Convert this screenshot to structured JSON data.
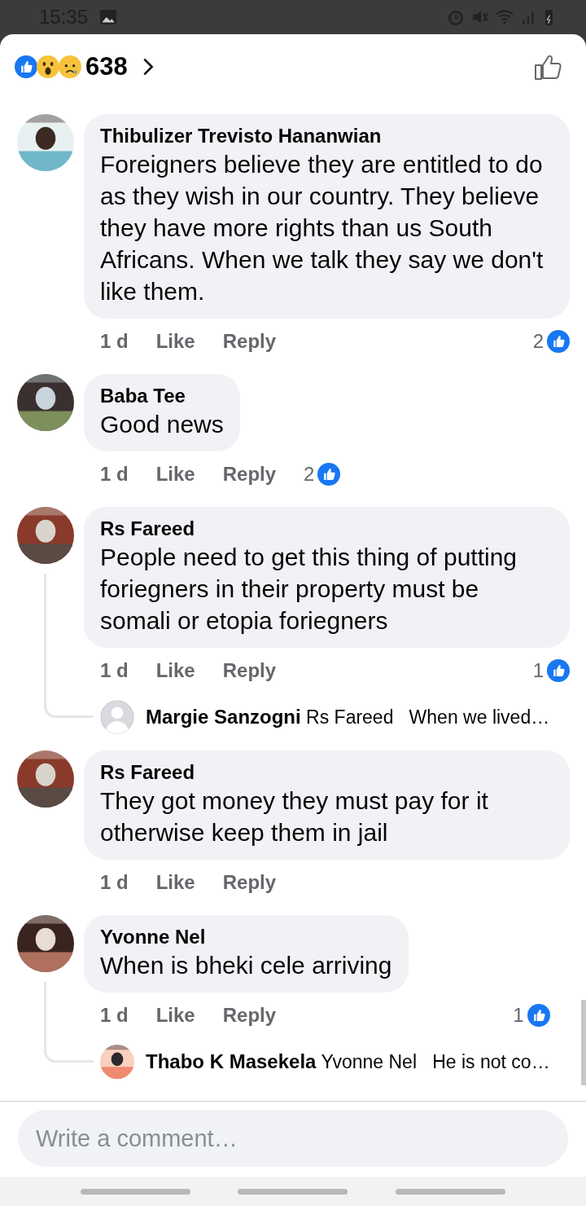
{
  "status_bar": {
    "time": "15:35"
  },
  "reactions": {
    "count": "638"
  },
  "comments": [
    {
      "author": "Thibulizer Trevisto Hananwian",
      "text": "Foreigners believe they are entitled to do as they wish in our country. They believe they have more rights than us South Africans. When we talk they say we don't like them.",
      "time": "1 d",
      "like": "Like",
      "reply": "Reply",
      "likes": "2"
    },
    {
      "author": "Baba Tee",
      "text": "Good news",
      "time": "1 d",
      "like": "Like",
      "reply": "Reply",
      "likes": "2"
    },
    {
      "author": "Rs Fareed",
      "text": "People need to get this thing of putting foriegners in their property must be somali or etopia foriegners",
      "time": "1 d",
      "like": "Like",
      "reply": "Reply",
      "likes": "1",
      "replies": [
        {
          "author": "Margie Sanzogni",
          "mention": "Rs Fareed",
          "text": "When we lived…",
          "photo": false
        }
      ]
    },
    {
      "author": "Rs Fareed",
      "text": "They got money they must pay for it otherwise keep them in jail",
      "time": "1 d",
      "like": "Like",
      "reply": "Reply"
    },
    {
      "author": "Yvonne Nel",
      "text": "When is bheki cele arriving",
      "time": "1 d",
      "like": "Like",
      "reply": "Reply",
      "likes": "1",
      "replies": [
        {
          "author": "Thabo K Masekela",
          "mention": "Yvonne Nel",
          "text": "He is not co…",
          "photo": true
        }
      ]
    }
  ],
  "composer": {
    "placeholder": "Write a comment…"
  }
}
